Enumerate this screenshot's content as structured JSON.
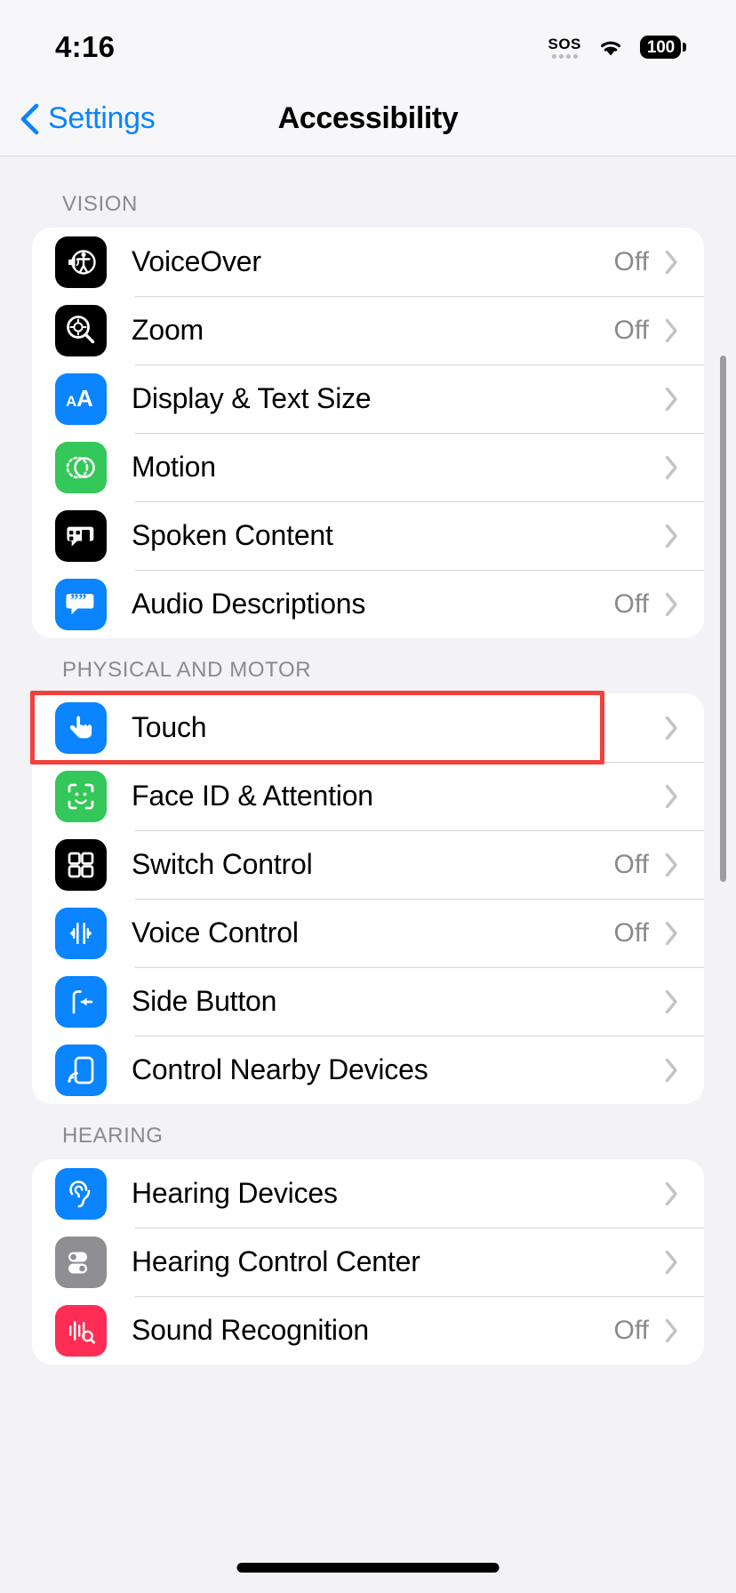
{
  "status_bar": {
    "time": "4:16",
    "sos_label": "SOS",
    "battery_percent": "100",
    "wifi_icon": "wifi-icon",
    "sos_icon": "sos-icon",
    "battery_icon": "battery-icon"
  },
  "nav": {
    "back_label": "Settings",
    "back_icon": "chevron-left-icon",
    "title": "Accessibility"
  },
  "sections": [
    {
      "header": "VISION",
      "rows": [
        {
          "label": "VoiceOver",
          "value": "Off",
          "icon": "voiceover-icon",
          "icon_color": "#000000"
        },
        {
          "label": "Zoom",
          "value": "Off",
          "icon": "zoom-magnifier-icon",
          "icon_color": "#000000"
        },
        {
          "label": "Display & Text Size",
          "value": "",
          "icon": "text-size-icon",
          "icon_color": "#0a84ff"
        },
        {
          "label": "Motion",
          "value": "",
          "icon": "motion-icon",
          "icon_color": "#34c759"
        },
        {
          "label": "Spoken Content",
          "value": "",
          "icon": "spoken-content-icon",
          "icon_color": "#000000"
        },
        {
          "label": "Audio Descriptions",
          "value": "Off",
          "icon": "audio-description-icon",
          "icon_color": "#0a84ff"
        }
      ]
    },
    {
      "header": "PHYSICAL AND MOTOR",
      "rows": [
        {
          "label": "Touch",
          "value": "",
          "icon": "touch-hand-icon",
          "icon_color": "#0a84ff",
          "highlighted": true
        },
        {
          "label": "Face ID & Attention",
          "value": "",
          "icon": "face-id-icon",
          "icon_color": "#34c759"
        },
        {
          "label": "Switch Control",
          "value": "Off",
          "icon": "switch-control-icon",
          "icon_color": "#000000"
        },
        {
          "label": "Voice Control",
          "value": "Off",
          "icon": "voice-control-icon",
          "icon_color": "#0a84ff"
        },
        {
          "label": "Side Button",
          "value": "",
          "icon": "side-button-icon",
          "icon_color": "#0a84ff"
        },
        {
          "label": "Control Nearby Devices",
          "value": "",
          "icon": "nearby-devices-icon",
          "icon_color": "#0a84ff"
        }
      ]
    },
    {
      "header": "HEARING",
      "rows": [
        {
          "label": "Hearing Devices",
          "value": "",
          "icon": "ear-icon",
          "icon_color": "#0a84ff"
        },
        {
          "label": "Hearing Control Center",
          "value": "",
          "icon": "toggles-icon",
          "icon_color": "#8e8e93"
        },
        {
          "label": "Sound Recognition",
          "value": "Off",
          "icon": "sound-recognition-icon",
          "icon_color": "#ff2d55"
        }
      ]
    }
  ],
  "chevron_icon": "chevron-right-icon",
  "highlight": {
    "color": "#f2403a",
    "target": "Touch"
  },
  "scrollbar_icon": "vertical-scrollbar",
  "home_indicator_icon": "home-indicator"
}
